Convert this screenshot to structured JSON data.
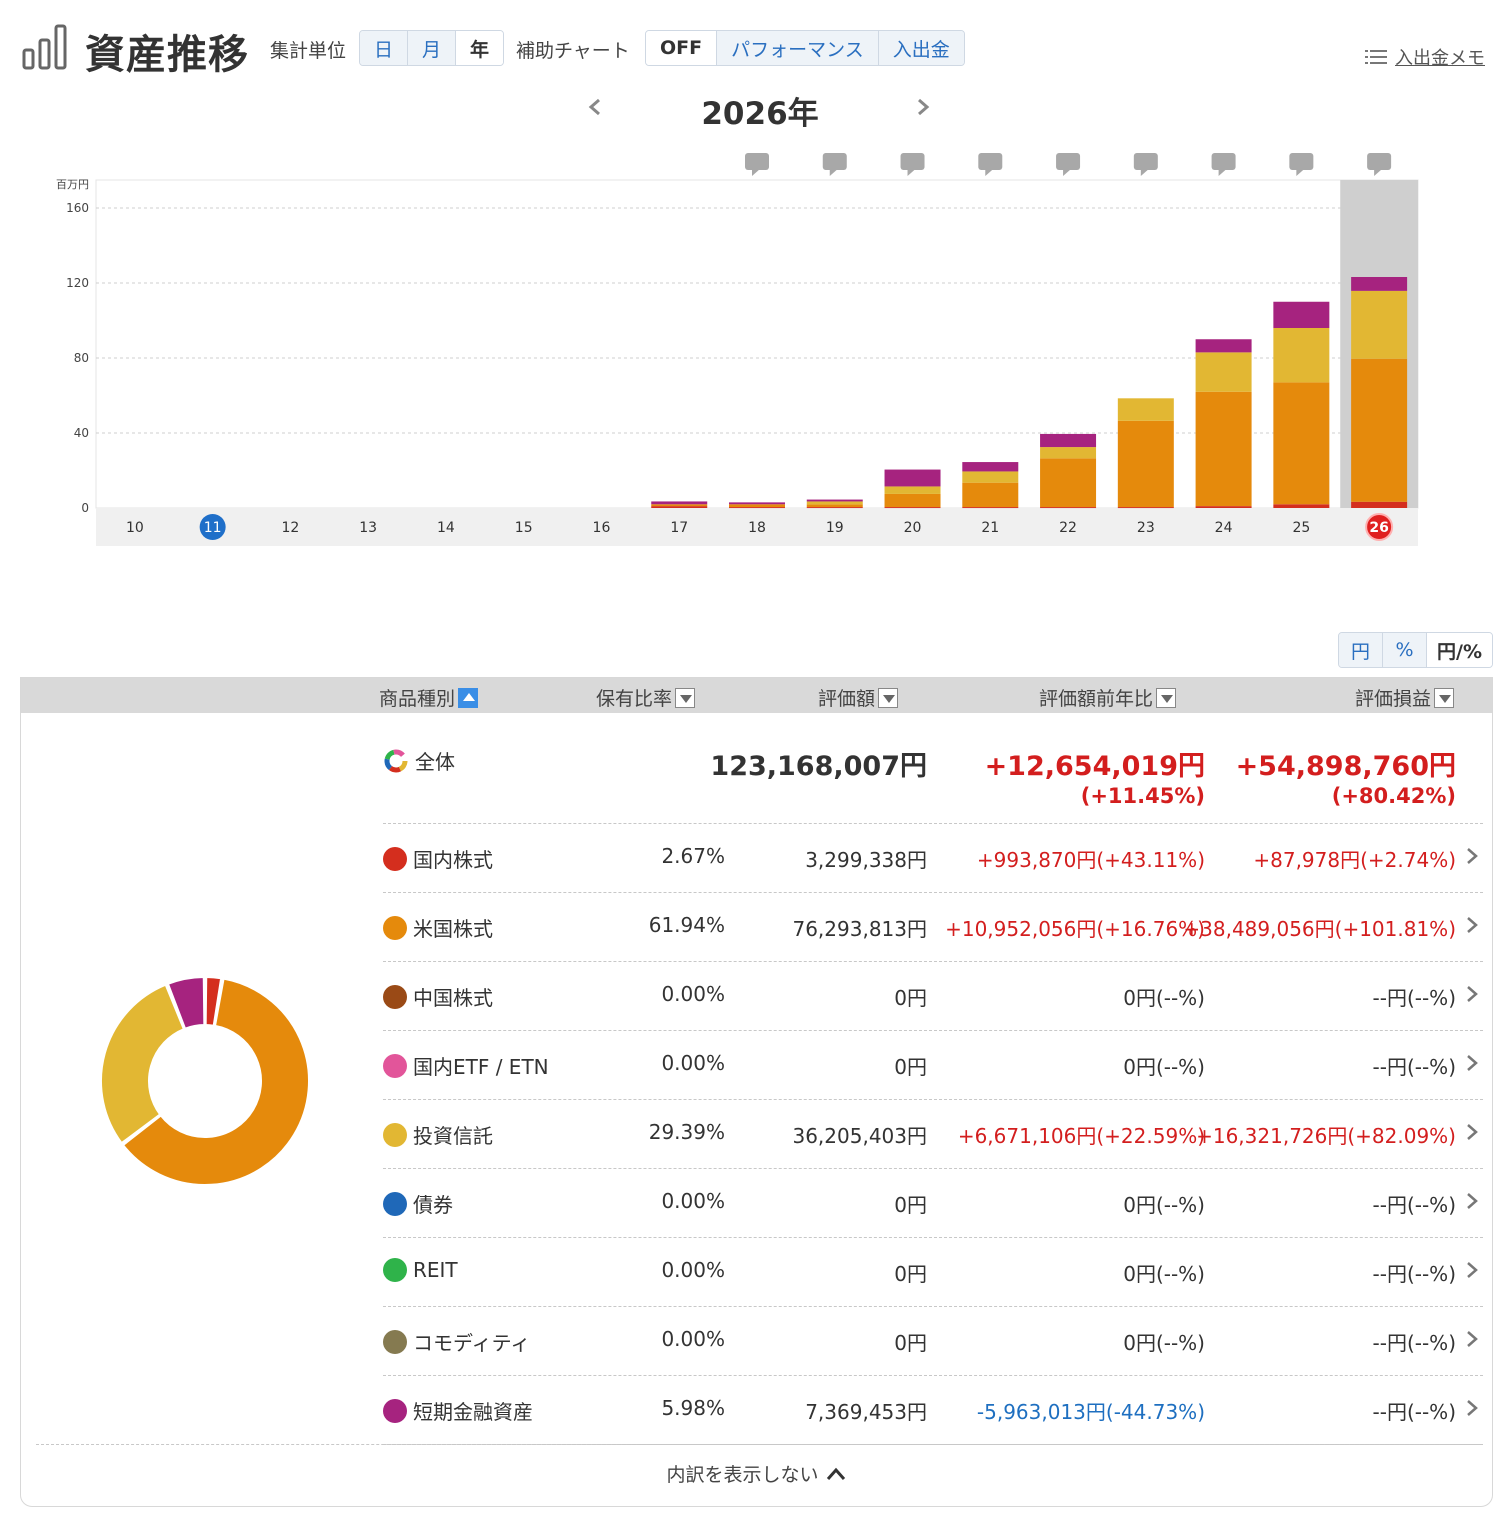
{
  "header": {
    "title": "資産推移",
    "unit_label": "集計単位",
    "unit_options": [
      "日",
      "月",
      "年"
    ],
    "unit_selected": "年",
    "aux_label": "補助チャート",
    "aux_options": [
      "OFF",
      "パフォーマンス",
      "入出金"
    ],
    "aux_selected": "OFF",
    "memo_link": "入出金メモ"
  },
  "year_nav": {
    "label": "2026年"
  },
  "chart_data": {
    "type": "bar",
    "stacked": true,
    "unit_label": "百万円",
    "ylim": [
      0,
      160
    ],
    "yticks": [
      "160",
      "120",
      "80",
      "40",
      "0"
    ],
    "categories": [
      "10",
      "11",
      "12",
      "13",
      "14",
      "15",
      "16",
      "17",
      "18",
      "19",
      "20",
      "21",
      "22",
      "23",
      "24",
      "25",
      "26"
    ],
    "highlight_today": "11",
    "highlight_selected": "26",
    "memo_markers_on": [
      "18",
      "19",
      "20",
      "21",
      "22",
      "23",
      "24",
      "25",
      "26"
    ],
    "series": [
      {
        "color": "#d42e1e",
        "values": [
          0,
          0,
          0,
          0,
          0,
          0,
          0,
          1,
          0.5,
          0.5,
          0.5,
          0.5,
          0.5,
          0.5,
          1,
          2,
          3.3
        ]
      },
      {
        "color": "#e58a0c",
        "values": [
          0,
          0,
          0,
          0,
          0,
          0,
          0,
          1,
          1.5,
          1.5,
          7,
          13,
          26,
          46,
          61,
          65,
          76.3
        ]
      },
      {
        "color": "#e2b733",
        "values": [
          0,
          0,
          0,
          0,
          0,
          0,
          0,
          0,
          0,
          1.5,
          4,
          6,
          6,
          12,
          21,
          29,
          36.2
        ]
      },
      {
        "color": "#a6237f",
        "values": [
          0,
          0,
          0,
          0,
          0,
          0,
          0,
          1.5,
          1,
          1,
          9,
          5,
          7,
          0,
          7,
          14,
          7.4
        ]
      }
    ]
  },
  "format_toggle": {
    "options": [
      "円",
      "%",
      "円/%"
    ],
    "selected": "円/%"
  },
  "table": {
    "headers": {
      "category": "商品種別",
      "ratio": "保有比率",
      "value": "評価額",
      "yoy": "評価額前年比",
      "gain": "評価損益"
    },
    "total": {
      "label": "全体",
      "value": "123,168,007円",
      "yoy": "+12,654,019円",
      "yoy_pct": "(+11.45%)",
      "gain": "+54,898,760円",
      "gain_pct": "(+80.42%)"
    },
    "rows": [
      {
        "label": "国内株式",
        "color": "#d42e1e",
        "ratio": "2.67%",
        "value": "3,299,338円",
        "yoy": "+993,870円(+43.11%)",
        "yoy_sign": "pos",
        "gain": "+87,978円(+2.74%)",
        "gain_sign": "pos"
      },
      {
        "label": "米国株式",
        "color": "#e58a0c",
        "ratio": "61.94%",
        "value": "76,293,813円",
        "yoy": "+10,952,056円(+16.76%)",
        "yoy_sign": "pos",
        "gain": "+38,489,056円(+101.81%)",
        "gain_sign": "pos"
      },
      {
        "label": "中国株式",
        "color": "#9a4a16",
        "ratio": "0.00%",
        "value": "0円",
        "yoy": "0円(--%)",
        "yoy_sign": "neu",
        "gain": "--円(--%)",
        "gain_sign": "neu"
      },
      {
        "label": "国内ETF / ETN",
        "color": "#e2559a",
        "ratio": "0.00%",
        "value": "0円",
        "yoy": "0円(--%)",
        "yoy_sign": "neu",
        "gain": "--円(--%)",
        "gain_sign": "neu"
      },
      {
        "label": "投資信託",
        "color": "#e2b733",
        "ratio": "29.39%",
        "value": "36,205,403円",
        "yoy": "+6,671,106円(+22.59%)",
        "yoy_sign": "pos",
        "gain": "+16,321,726円(+82.09%)",
        "gain_sign": "pos"
      },
      {
        "label": "債券",
        "color": "#1f68b8",
        "ratio": "0.00%",
        "value": "0円",
        "yoy": "0円(--%)",
        "yoy_sign": "neu",
        "gain": "--円(--%)",
        "gain_sign": "neu"
      },
      {
        "label": "REIT",
        "color": "#2fb34a",
        "ratio": "0.00%",
        "value": "0円",
        "yoy": "0円(--%)",
        "yoy_sign": "neu",
        "gain": "--円(--%)",
        "gain_sign": "neu"
      },
      {
        "label": "コモディティ",
        "color": "#857a50",
        "ratio": "0.00%",
        "value": "0円",
        "yoy": "0円(--%)",
        "yoy_sign": "neu",
        "gain": "--円(--%)",
        "gain_sign": "neu"
      },
      {
        "label": "短期金融資産",
        "color": "#a6237f",
        "ratio": "5.98%",
        "value": "7,369,453円",
        "yoy": "-5,963,013円(-44.73%)",
        "yoy_sign": "neg",
        "gain": "--円(--%)",
        "gain_sign": "neu"
      }
    ],
    "donut_values": [
      2.67,
      61.94,
      0,
      0,
      29.39,
      0,
      0,
      0,
      5.98
    ],
    "footer_toggle": "内訳を表示しない"
  }
}
